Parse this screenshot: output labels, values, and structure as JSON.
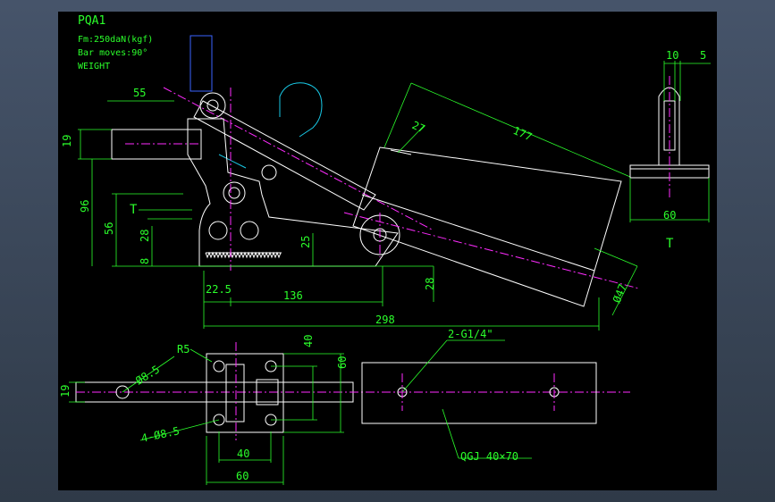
{
  "colors": {
    "background": "#000000",
    "dimension": "#2bff2b",
    "outline": "#ffffff",
    "centerline": "#ff2bff",
    "hidden": "#3a63ff",
    "handle": "#19c9e6"
  },
  "header": {
    "model": "PQA1",
    "force": "Fm:250daN(kgf)",
    "bar_moves": "Bar moves:90°",
    "weight": "WEIGHT"
  },
  "dims": {
    "d55": "55",
    "d19a": "19",
    "d96": "96",
    "d56": "56",
    "d28a": "28",
    "d8": "8",
    "d25": "25",
    "d22": "22.5",
    "d136": "136",
    "d28b": "28",
    "d298": "298",
    "d27": "27",
    "d177": "177",
    "d47": "Ø47",
    "d10": "10",
    "d5": "5",
    "d60a": "60",
    "d60b": "60",
    "d40a": "40",
    "d40b": "40",
    "d60c": "60",
    "d19b": "19",
    "r5": "R5",
    "phi85": "Ø8.5",
    "phi85x4": "4-Ø8.5",
    "g14": "2-G1/4\"",
    "qgj": "QGJ 40×70"
  },
  "labels": {
    "t_left": "T",
    "t_right": "T"
  }
}
